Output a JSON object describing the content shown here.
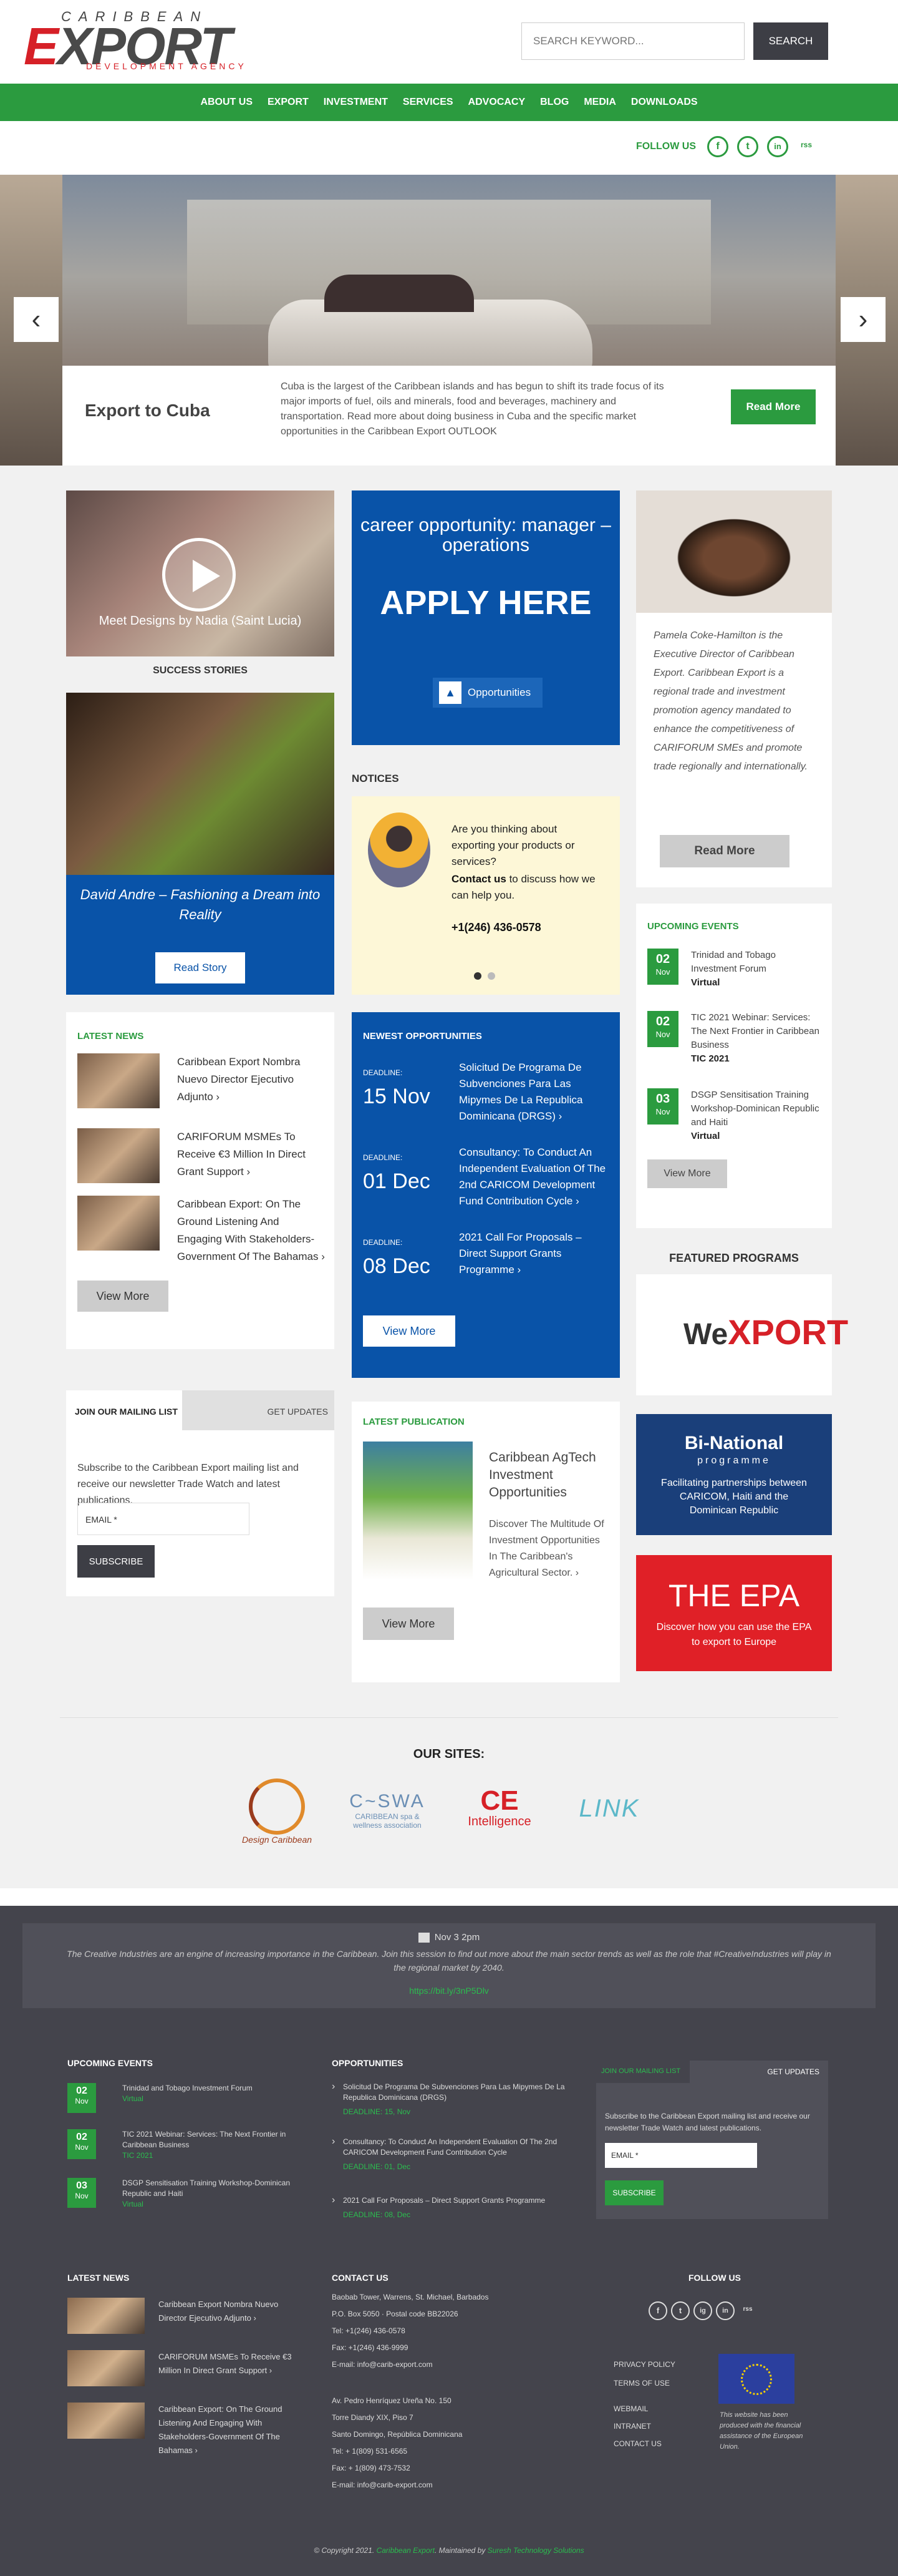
{
  "header": {
    "logo": {
      "top": "CARIBBEAN",
      "main_a": "E",
      "main_b": "XPORT",
      "sub": "DEVELOPMENT AGENCY"
    },
    "search": {
      "placeholder": "SEARCH KEYWORD...",
      "button": "SEARCH"
    }
  },
  "nav": [
    "ABOUT US",
    "EXPORT",
    "INVESTMENT",
    "SERVICES",
    "ADVOCACY",
    "BLOG",
    "MEDIA",
    "DOWNLOADS"
  ],
  "follow": {
    "label": "FOLLOW US",
    "icons": [
      "facebook-icon",
      "twitter-icon",
      "linkedin-icon",
      "rss-icon"
    ],
    "glyphs": [
      "f",
      "t",
      "in",
      "rss"
    ]
  },
  "hero": {
    "title": "Export to Cuba",
    "text": "Cuba is the largest of the Caribbean islands and has begun to shift its trade focus of its major imports of fuel, oils and minerals, food and beverages, machinery and transportation. Read more about doing business in Cuba and the specific market opportunities in the Caribbean Export OUTLOOK",
    "button": "Read More",
    "prev": "‹",
    "next": "›"
  },
  "video": {
    "caption": "Meet Designs by Nadia (Saint Lucia)"
  },
  "success": {
    "title": "SUCCESS STORIES",
    "story": "David Andre – Fashioning a Dream into Reality",
    "button": "Read Story"
  },
  "career": {
    "line1": "career opportunity: manager – operations",
    "line2": "APPLY HERE",
    "button": "Opportunities"
  },
  "notices": {
    "title": "NOTICES",
    "question": "Are you thinking about exporting your products or services?",
    "contact_bold": "Contact us",
    "contact_rest": " to discuss how we can help you.",
    "phone": "+1(246) 436-0578"
  },
  "exec": {
    "text": "Pamela Coke-Hamilton is the Executive Director of Caribbean Export. Caribbean Export is a regional trade and investment promotion agency mandated to enhance the competitiveness of CARIFORUM SMEs and promote trade regionally and internationally.",
    "button": "Read More"
  },
  "events": {
    "title": "UPCOMING EVENTS",
    "items": [
      {
        "day": "02",
        "month": "Nov",
        "title": "Trinidad and Tobago Investment Forum",
        "tag": "Virtual"
      },
      {
        "day": "02",
        "month": "Nov",
        "title": "TIC 2021 Webinar: Services: The Next Frontier in Caribbean Business",
        "tag": "TIC 2021"
      },
      {
        "day": "03",
        "month": "Nov",
        "title": "DSGP Sensitisation Training Workshop-Dominican Republic and Haiti",
        "tag": "Virtual"
      }
    ],
    "button": "View More"
  },
  "news": {
    "title": "LATEST NEWS",
    "items": [
      {
        "title": "Caribbean Export Nombra Nuevo Director Ejecutivo Adjunto"
      },
      {
        "title": "CARIFORUM MSMEs To Receive €3 Million In Direct Grant Support"
      },
      {
        "title": "Caribbean Export: On The Ground Listening And Engaging With Stakeholders-Government Of The Bahamas"
      }
    ],
    "button": "View More"
  },
  "opps": {
    "title": "NEWEST OPPORTUNITIES",
    "deadline_label": "DEADLINE:",
    "items": [
      {
        "date": "15 Nov",
        "title": "Solicitud De Programa De Subvenciones Para Las Mipymes De La Republica Dominicana (DRGS)"
      },
      {
        "date": "01 Dec",
        "title": "Consultancy: To Conduct An Independent Evaluation Of The 2nd CARICOM Development Fund Contribution Cycle"
      },
      {
        "date": "08 Dec",
        "title": "2021 Call For Proposals – Direct Support Grants Programme"
      }
    ],
    "button": "View More"
  },
  "featured": {
    "title": "FEATURED PROGRAMS",
    "wexport_a": "We",
    "wexport_b": "XPORT",
    "binational_title": "Bi-National",
    "binational_sub": "programme",
    "binational_text": "Facilitating partnerships between CARICOM, Haiti and the Dominican Republic",
    "epa_title": "THE EPA",
    "epa_text": "Discover how you can use the EPA to export to Europe"
  },
  "mailing": {
    "tab1": "JOIN OUR MAILING LIST",
    "tab2": "GET UPDATES",
    "text": "Subscribe to the Caribbean Export mailing list and receive our newsletter Trade Watch and latest publications.",
    "placeholder": "EMAIL *",
    "button": "SUBSCRIBE"
  },
  "publication": {
    "title": "LATEST PUBLICATION",
    "name": "Caribbean AgTech Investment Opportunities",
    "desc": "Discover The Multitude Of Investment Opportunities In The Caribbean's Agricultural Sector.",
    "button": "View More"
  },
  "sites": {
    "title": "OUR SITES:",
    "items": [
      {
        "name": "Design Caribbean",
        "color": "#9a3b1d"
      },
      {
        "name": "C~SWA",
        "sub": "CARIBBEAN spa & wellness association",
        "color": "#6b8fb5"
      },
      {
        "name": "CE",
        "sub": "Intelligence",
        "color": "#d62027"
      },
      {
        "name": "LINK",
        "color": "#5cb8c9"
      }
    ]
  },
  "tweet": {
    "meta": "Nov 3 2pm",
    "text": "The Creative Industries are an engine of increasing importance in the Caribbean. Join this session to find out more about the main sector trends as well as the role that #CreativeIndustries will play in the regional market by 2040.",
    "link": "https://bit.ly/3nP5Dlv"
  },
  "footer": {
    "events_title": "UPCOMING EVENTS",
    "opps_title": "OPPORTUNITIES",
    "opps": [
      {
        "title": "Solicitud De Programa De Subvenciones Para Las Mipymes De La Republica Dominicana (DRGS)",
        "deadline": "DEADLINE: 15, Nov"
      },
      {
        "title": "Consultancy: To Conduct An Independent Evaluation Of The 2nd CARICOM Development Fund Contribution Cycle",
        "deadline": "DEADLINE: 01, Dec"
      },
      {
        "title": "2021 Call For Proposals – Direct Support Grants Programme",
        "deadline": "DEADLINE: 08, Dec"
      }
    ],
    "mail_tab1": "JOIN OUR MAILING LIST",
    "mail_tab2": "GET UPDATES",
    "mail_text": "Subscribe to the Caribbean Export mailing list and receive our newsletter Trade Watch and latest publications.",
    "mail_placeholder": "EMAIL *",
    "mail_button": "SUBSCRIBE",
    "news_title": "LATEST NEWS",
    "news": [
      "Caribbean Export Nombra Nuevo Director Ejecutivo Adjunto",
      "CARIFORUM MSMEs To Receive €3 Million In Direct Grant Support",
      "Caribbean Export: On The Ground Listening And Engaging With Stakeholders-Government Of The Bahamas"
    ],
    "contact_title": "CONTACT US",
    "contact1": [
      "Baobab Tower, Warrens, St. Michael, Barbados",
      "P.O. Box 5050 · Postal code BB22026",
      "Tel: +1(246) 436-0578",
      "Fax: +1(246) 436-9999",
      "E-mail: info@carib-export.com"
    ],
    "contact2": [
      "Av. Pedro Henríquez Ureña No. 150",
      "Torre Diandy XIX, Piso 7",
      "Santo Domingo, República Dominicana",
      "Tel: + 1(809) 531-6565",
      "Fax: + 1(809) 473-7532",
      "E-mail: info@carib-export.com"
    ],
    "follow_title": "FOLLOW US",
    "follow_glyphs": [
      "f",
      "t",
      "ig",
      "in",
      "rss"
    ],
    "links1": [
      "PRIVACY POLICY",
      "TERMS OF USE"
    ],
    "links2": [
      "WEBMAIL",
      "INTRANET",
      "CONTACT US"
    ],
    "eu_text": "This website has been produced with the financial assistance of the European Union.",
    "copy_a": "© Copyright 2021. ",
    "copy_b": "Caribbean Export",
    "copy_c": ". Maintained by ",
    "copy_d": "Suresh Technology Solutions"
  }
}
